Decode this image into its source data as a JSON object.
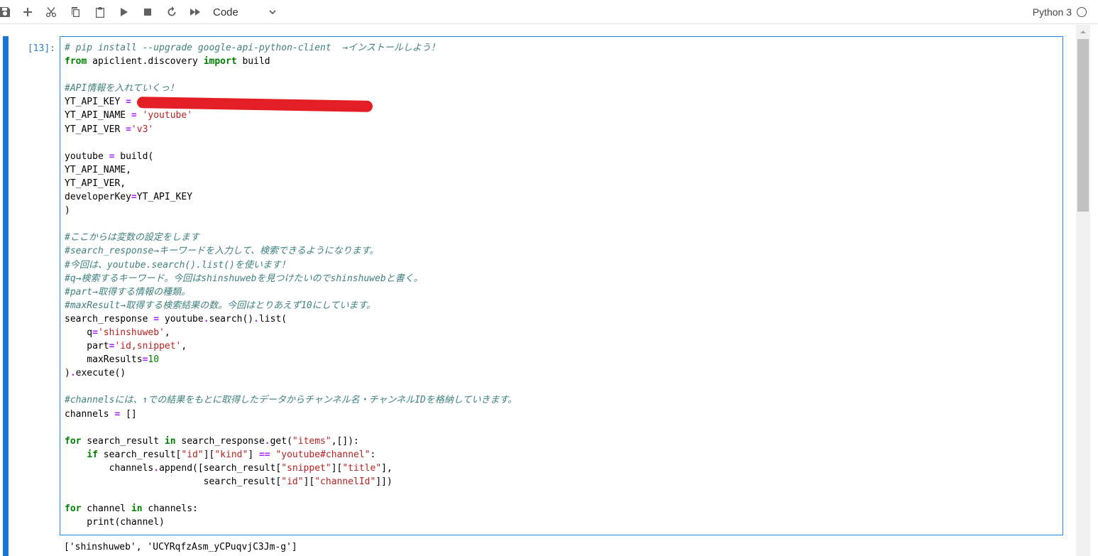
{
  "toolbar": {
    "buttons": [
      "save-icon",
      "add-cell-icon",
      "cut-icon",
      "copy-icon",
      "paste-icon",
      "run-icon",
      "stop-icon",
      "restart-icon",
      "run-all-icon"
    ],
    "cell_type": "Code",
    "kernel_name": "Python 3"
  },
  "cell": {
    "prompt": "[13]:",
    "lines": [
      [
        {
          "t": "c",
          "v": "# pip install --upgrade google-api-python-client  →インストールしよう！"
        }
      ],
      [
        {
          "t": "k",
          "v": "from"
        },
        {
          "t": "n",
          "v": " apiclient.discovery "
        },
        {
          "t": "k",
          "v": "import"
        },
        {
          "t": "n",
          "v": " build"
        }
      ],
      [],
      [
        {
          "t": "c",
          "v": "#API情報を入れていくっ！"
        }
      ],
      [
        {
          "t": "n",
          "v": "YT_API_KEY "
        },
        {
          "t": "o",
          "v": "="
        }
      ],
      [
        {
          "t": "n",
          "v": "YT_API_NAME "
        },
        {
          "t": "o",
          "v": "="
        },
        {
          "t": "n",
          "v": " "
        },
        {
          "t": "s",
          "v": "'youtube'"
        }
      ],
      [
        {
          "t": "n",
          "v": "YT_API_VER "
        },
        {
          "t": "o",
          "v": "="
        },
        {
          "t": "s",
          "v": "'v3'"
        }
      ],
      [],
      [
        {
          "t": "n",
          "v": "youtube "
        },
        {
          "t": "o",
          "v": "="
        },
        {
          "t": "n",
          "v": " build("
        }
      ],
      [
        {
          "t": "n",
          "v": "YT_API_NAME,"
        }
      ],
      [
        {
          "t": "n",
          "v": "YT_API_VER,"
        }
      ],
      [
        {
          "t": "n",
          "v": "developerKey"
        },
        {
          "t": "o",
          "v": "="
        },
        {
          "t": "n",
          "v": "YT_API_KEY"
        }
      ],
      [
        {
          "t": "n",
          "v": ")"
        }
      ],
      [],
      [
        {
          "t": "c",
          "v": "#ここからは変数の設定をします"
        }
      ],
      [
        {
          "t": "c",
          "v": "#search_response→キーワードを入力して、検索できるようになります。"
        }
      ],
      [
        {
          "t": "c",
          "v": "#今回は、youtube.search().list()を使います！"
        }
      ],
      [
        {
          "t": "c",
          "v": "#q→検索するキーワード。今回はshinshuwebを見つけたいのでshinshuwebと書く。"
        }
      ],
      [
        {
          "t": "c",
          "v": "#part→取得する情報の種類。"
        }
      ],
      [
        {
          "t": "c",
          "v": "#maxResult→取得する検索結果の数。今回はとりあえず10にしています。"
        }
      ],
      [
        {
          "t": "n",
          "v": "search_response "
        },
        {
          "t": "o",
          "v": "="
        },
        {
          "t": "n",
          "v": " youtube"
        },
        {
          "t": "o",
          "v": "."
        },
        {
          "t": "n",
          "v": "search()"
        },
        {
          "t": "o",
          "v": "."
        },
        {
          "t": "n",
          "v": "list("
        }
      ],
      [
        {
          "t": "n",
          "v": "    q"
        },
        {
          "t": "o",
          "v": "="
        },
        {
          "t": "s",
          "v": "'shinshuweb'"
        },
        {
          "t": "n",
          "v": ","
        }
      ],
      [
        {
          "t": "n",
          "v": "    part"
        },
        {
          "t": "o",
          "v": "="
        },
        {
          "t": "s",
          "v": "'id,snippet'"
        },
        {
          "t": "n",
          "v": ","
        }
      ],
      [
        {
          "t": "n",
          "v": "    maxResults"
        },
        {
          "t": "o",
          "v": "="
        },
        {
          "t": "m",
          "v": "10"
        }
      ],
      [
        {
          "t": "n",
          "v": ")"
        },
        {
          "t": "o",
          "v": "."
        },
        {
          "t": "n",
          "v": "execute()"
        }
      ],
      [],
      [
        {
          "t": "c",
          "v": "#channelsには、↑での結果をもとに取得したデータからチャンネル名・チャンネルIDを格納していきます。"
        }
      ],
      [
        {
          "t": "n",
          "v": "channels "
        },
        {
          "t": "o",
          "v": "="
        },
        {
          "t": "n",
          "v": " []"
        }
      ],
      [],
      [
        {
          "t": "k",
          "v": "for"
        },
        {
          "t": "n",
          "v": " search_result "
        },
        {
          "t": "k",
          "v": "in"
        },
        {
          "t": "n",
          "v": " search_response"
        },
        {
          "t": "o",
          "v": "."
        },
        {
          "t": "n",
          "v": "get("
        },
        {
          "t": "s",
          "v": "\"items\""
        },
        {
          "t": "n",
          "v": ",[]):"
        }
      ],
      [
        {
          "t": "n",
          "v": "    "
        },
        {
          "t": "k",
          "v": "if"
        },
        {
          "t": "n",
          "v": " search_result["
        },
        {
          "t": "s",
          "v": "\"id\""
        },
        {
          "t": "n",
          "v": "]["
        },
        {
          "t": "s",
          "v": "\"kind\""
        },
        {
          "t": "n",
          "v": "] "
        },
        {
          "t": "o",
          "v": "=="
        },
        {
          "t": "n",
          "v": " "
        },
        {
          "t": "s",
          "v": "\"youtube#channel\""
        },
        {
          "t": "n",
          "v": ":"
        }
      ],
      [
        {
          "t": "n",
          "v": "        channels"
        },
        {
          "t": "o",
          "v": "."
        },
        {
          "t": "n",
          "v": "append([search_result["
        },
        {
          "t": "s",
          "v": "\"snippet\""
        },
        {
          "t": "n",
          "v": "]["
        },
        {
          "t": "s",
          "v": "\"title\""
        },
        {
          "t": "n",
          "v": "],"
        }
      ],
      [
        {
          "t": "n",
          "v": "                         search_result["
        },
        {
          "t": "s",
          "v": "\"id\""
        },
        {
          "t": "n",
          "v": "]["
        },
        {
          "t": "s",
          "v": "\"channelId\""
        },
        {
          "t": "n",
          "v": "]])"
        }
      ],
      [],
      [
        {
          "t": "k",
          "v": "for"
        },
        {
          "t": "n",
          "v": " channel "
        },
        {
          "t": "k",
          "v": "in"
        },
        {
          "t": "n",
          "v": " channels:"
        }
      ],
      [
        {
          "t": "n",
          "v": "    print(channel)"
        }
      ]
    ],
    "output": "['shinshuweb', 'UCYRqfzAsm_yCPuqvjC3Jm-g']"
  },
  "colors": {
    "accent": "#1976d2",
    "editor_border": "#1e88e5",
    "redaction": "#e31e24",
    "comment": "#408080",
    "keyword": "#008000",
    "string": "#ba2121",
    "operator": "#aa22ff"
  }
}
